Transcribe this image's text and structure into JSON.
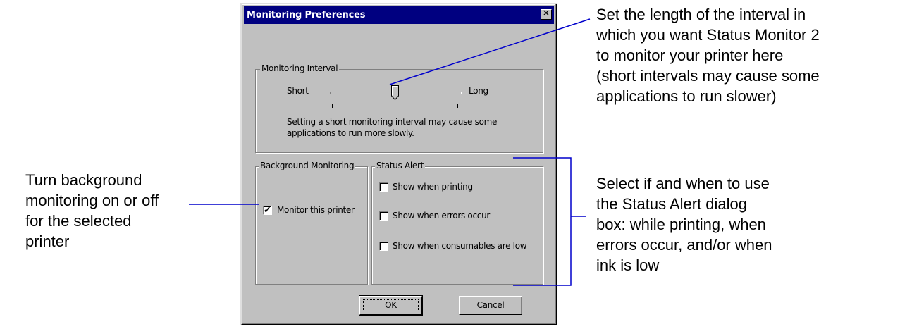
{
  "dialog": {
    "title": "Monitoring Preferences",
    "close_glyph": "✕",
    "monitoring_interval": {
      "group_label": "Monitoring Interval",
      "short_label": "Short",
      "long_label": "Long",
      "slider_level": 0.5,
      "ticks": 3,
      "note_lines": [
        "Setting a short monitoring interval may cause some",
        "applications to run more slowly."
      ]
    },
    "background_monitoring": {
      "group_label": "Background Monitoring",
      "checkbox_label": "Monitor this printer",
      "checked": true
    },
    "status_alert": {
      "group_label": "Status Alert",
      "options": [
        {
          "label": "Show when printing",
          "checked": false
        },
        {
          "label": "Show when errors occur",
          "checked": false
        },
        {
          "label": "Show when consumables are low",
          "checked": false
        }
      ]
    },
    "buttons": {
      "ok": "OK",
      "cancel": "Cancel"
    }
  },
  "callouts": {
    "interval": [
      "Set the length of the interval in",
      "which you want Status Monitor 2",
      "to monitor your printer here",
      "(short intervals may cause some",
      "applications to run slower)"
    ],
    "background": [
      "Turn background",
      "monitoring on or off",
      "for the selected",
      "printer"
    ],
    "status_alert": [
      "Select if and when to use",
      "the Status Alert dialog",
      "box: while printing, when",
      "errors occur, and/or when",
      "ink is low"
    ]
  },
  "colors": {
    "titlebar": "#000080",
    "dialog_face": "#c0c0c0",
    "leader_line": "#0000cc"
  },
  "icons": {
    "close": "close-icon",
    "check": "checkmark-icon",
    "slider_thumb": "slider-thumb-icon"
  }
}
